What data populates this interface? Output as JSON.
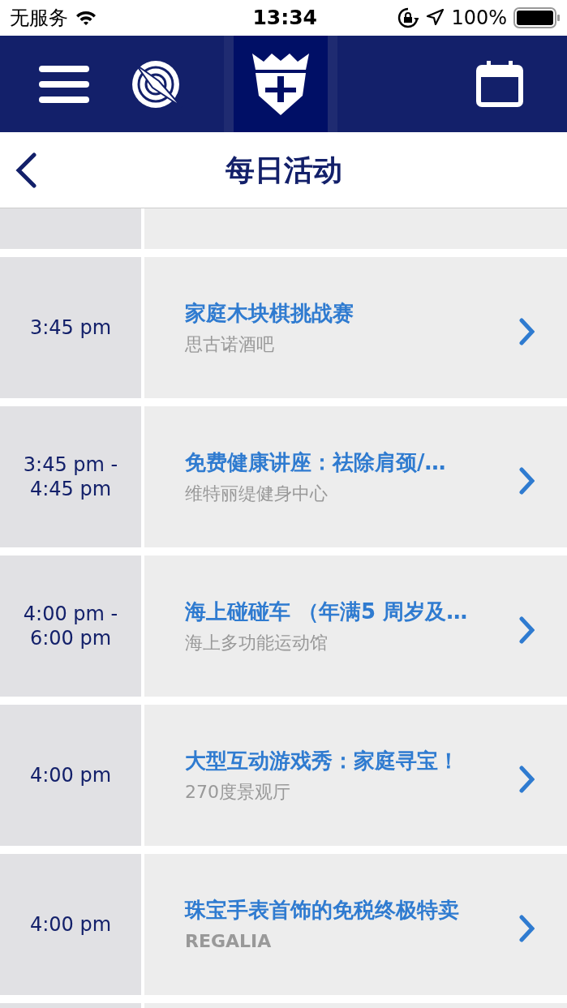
{
  "status_bar": {
    "carrier": "无服务",
    "time": "13:34",
    "battery": "100%"
  },
  "page_title": "每日活动",
  "activities": [
    {
      "time": "3:45 pm",
      "title": "家庭木块棋挑战赛",
      "location": "思古诺酒吧"
    },
    {
      "time": "3:45 pm - 4:45 pm",
      "title": "免费健康讲座：祛除肩颈/…",
      "location": "维特丽缇健身中心"
    },
    {
      "time": "4:00 pm - 6:00 pm",
      "title": "海上碰碰车 （年满5 周岁及…",
      "location": "海上多功能运动馆"
    },
    {
      "time": "4:00 pm",
      "title": "大型互动游戏秀：家庭寻宝！",
      "location": "270度景观厅"
    },
    {
      "time": "4:00 pm",
      "title": "珠宝手表首饰的免税终极特卖",
      "location": "REGALIA"
    }
  ]
}
